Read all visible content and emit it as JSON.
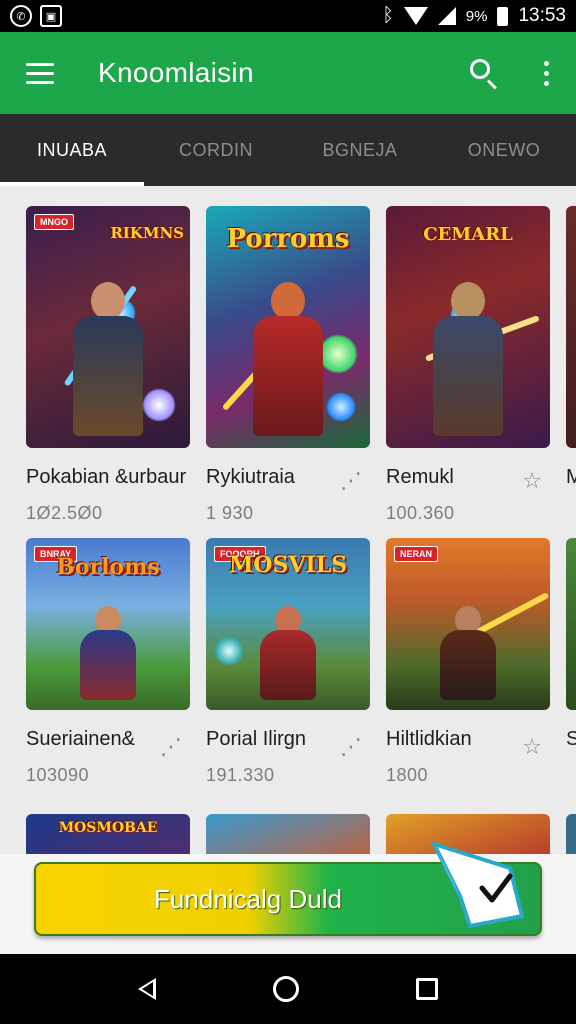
{
  "status_bar": {
    "icons": [
      "whatsapp-icon",
      "gallery-icon",
      "bluetooth-icon",
      "wifi-icon",
      "signal-icon",
      "battery-icon"
    ],
    "battery": "9%",
    "time": "13:53"
  },
  "app_bar": {
    "title": "Knoomlaisin",
    "icons": [
      "menu-icon",
      "search-icon",
      "more-vert-icon"
    ]
  },
  "tabs": [
    {
      "label": "INUABA",
      "active": true
    },
    {
      "label": "CORDIN",
      "active": false
    },
    {
      "label": "BGNEJA",
      "active": false
    },
    {
      "label": "ONEWO",
      "active": false
    }
  ],
  "games": {
    "row1": [
      {
        "title": "Pokabian &urbaur",
        "price": "1Ø2.5Ø0",
        "badge": "MNGO",
        "logo": "RIKMNS",
        "action_icon": "share-icon",
        "logo_color": "#ffcf2e"
      },
      {
        "title": "Rykiutraia",
        "price": "1 930",
        "badge": "",
        "logo": "Porroms",
        "action_icon": "share-icon",
        "logo_color": "#ffcf2e"
      },
      {
        "title": "Remukl",
        "price": "100.360",
        "badge": "",
        "logo": "CEMARL",
        "action_icon": "star-icon",
        "logo_color": "#ffcf2e"
      },
      {
        "title": "M",
        "price": "",
        "badge": "",
        "logo": "",
        "action_icon": "",
        "logo_color": "#ffcf2e"
      }
    ],
    "row2": [
      {
        "title": "Sueriainen&",
        "price": "103090",
        "badge": "BNRAY",
        "logo": "Borloms",
        "action_icon": "share-icon",
        "logo_color": "#ff8c1a"
      },
      {
        "title": "Porial Ilirgn",
        "price": "191.330",
        "badge": "FOOORH",
        "logo": "MOSVILS",
        "action_icon": "share-icon",
        "logo_color": "#ffcf2e"
      },
      {
        "title": "Hiltlidkian",
        "price": "1800",
        "badge": "NERAN",
        "logo": "",
        "action_icon": "star-icon",
        "logo_color": "#ffcf2e"
      },
      {
        "title": "S",
        "price": "",
        "badge": "",
        "logo": "",
        "action_icon": "",
        "logo_color": "#ffcf2e"
      }
    ],
    "row3_logos": [
      "MOSMOBAE",
      "",
      "",
      ""
    ]
  },
  "cta": {
    "label": "Fundnicalg Duld",
    "icon": "check-flag-icon"
  },
  "nav_bar": {
    "icons": [
      "back-icon",
      "home-icon",
      "recents-icon"
    ]
  }
}
